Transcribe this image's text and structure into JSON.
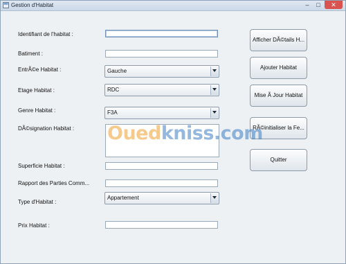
{
  "window": {
    "title": "Gestion d'Habitat"
  },
  "form": {
    "identifiant_label": "Identifiant de l'habitat :",
    "batiment_label": "Batiment :",
    "entree_label": "EntrÃ©e Habitat :",
    "entree_value": "Gauche",
    "etage_label": "Etage Habitat :",
    "etage_value": "RDC",
    "genre_label": "Genre Habitat :",
    "genre_value": "F3A",
    "designation_label": "DÃ©signation Habitat :",
    "superficie_label": "Superficie Habitat :",
    "rapport_label": "Rapport des Parties Comm...",
    "type_label": "Type d'Habitat :",
    "type_value": "Appartement",
    "prix_label": "Prix Habitat :"
  },
  "buttons": {
    "details": "Afficher DÃ©tails H...",
    "add": "Ajouter Habitat",
    "update": "Mise Ã  Jour Habitat",
    "reset": "RÃ©initialiser la Fe...",
    "quit": "Quitter"
  },
  "watermark": {
    "part1": "Oued",
    "part2": "kniss",
    "part3": ".com"
  },
  "colors": {
    "watermark_orange": "#f0a030",
    "watermark_blue": "#3d7fc4",
    "close_red": "#d9534f"
  },
  "icons": [
    "window-app-icon",
    "minimize-icon",
    "maximize-icon",
    "close-icon",
    "dropdown-arrow-icon"
  ]
}
